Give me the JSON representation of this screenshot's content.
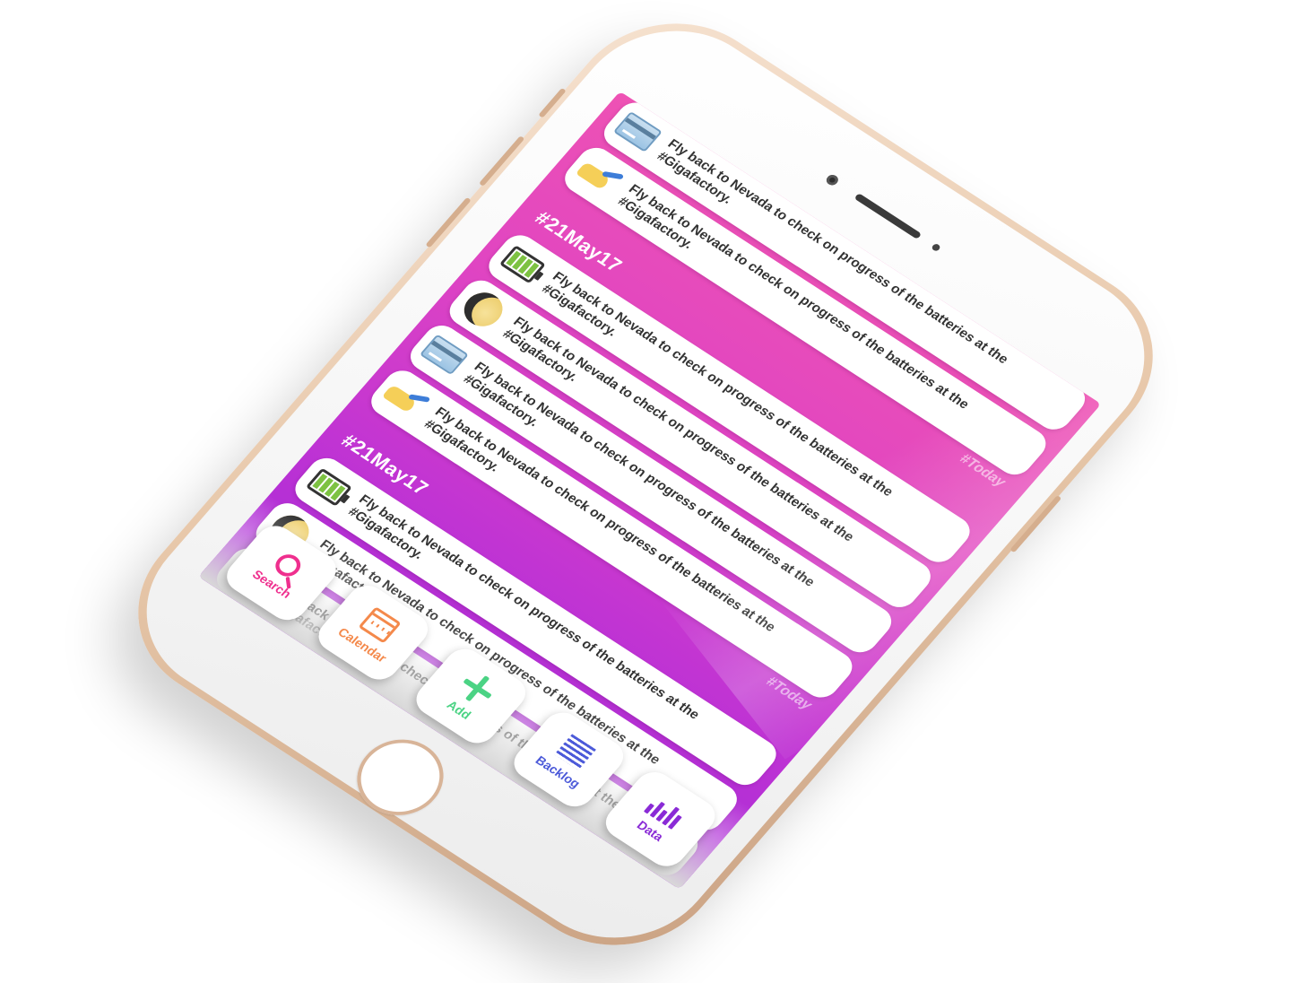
{
  "feed": [
    {
      "kind": "card",
      "icon": "credit-card-icon",
      "text": "Fly back to Nevada to check on progress of the batteries at the #Gigafactory."
    },
    {
      "kind": "card",
      "icon": "hand-icon",
      "text": "Fly back to Nevada to check on progress of the batteries at the #Gigafactory."
    },
    {
      "kind": "today",
      "text": "#Today"
    },
    {
      "kind": "header",
      "text": "#21May17"
    },
    {
      "kind": "card",
      "icon": "battery-icon",
      "text": "Fly back to Nevada to check on progress of the batteries at the #Gigafactory."
    },
    {
      "kind": "card",
      "icon": "moon-icon",
      "text": "Fly back to Nevada to check on progress of the batteries at the #Gigafactory."
    },
    {
      "kind": "card",
      "icon": "credit-card-icon",
      "text": "Fly back to Nevada to check on progress of the batteries at the #Gigafactory."
    },
    {
      "kind": "card",
      "icon": "hand-icon",
      "text": "Fly back to Nevada to check on progress of the batteries at the #Gigafactory."
    },
    {
      "kind": "today",
      "text": "#Today"
    },
    {
      "kind": "header",
      "text": "#21May17"
    },
    {
      "kind": "card",
      "icon": "battery-icon",
      "text": "Fly back to Nevada to check on progress of the batteries at the #Gigafactory."
    },
    {
      "kind": "card",
      "icon": "moon-icon",
      "text": "Fly back to Nevada to check on progress of the batteries at the #Gigafactory."
    },
    {
      "kind": "card",
      "icon": "credit-card-icon",
      "text": "Fly back to Nevada to check on progress of the batteries at the #Gigafactory."
    }
  ],
  "tabbar": {
    "search": {
      "label": "Search",
      "icon": "search-icon"
    },
    "calendar": {
      "label": "Calendar",
      "icon": "calendar-icon"
    },
    "add": {
      "label": "Add",
      "icon": "plus-icon"
    },
    "backlog": {
      "label": "Backlog",
      "icon": "list-icon"
    },
    "data": {
      "label": "Data",
      "icon": "chart-icon"
    }
  },
  "colors": {
    "gradient_top": "#ee52b4",
    "gradient_bottom": "#a52ad8",
    "search": "#ef2f8e",
    "calendar": "#f4894b",
    "add": "#4bd384",
    "backlog": "#4c5ad9",
    "data": "#8a2bd6"
  }
}
